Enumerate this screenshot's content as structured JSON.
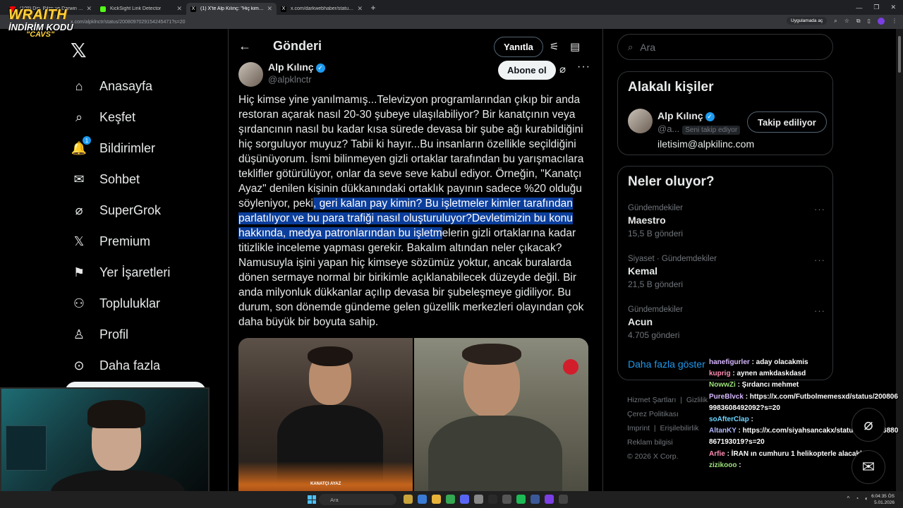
{
  "browser": {
    "tabs": [
      {
        "title": "(108) Din, Bilim ve Darwin - You",
        "color": "#ff0000"
      },
      {
        "title": "KickSight Link Detector",
        "color": "#53fc18"
      },
      {
        "title": "(1) X'te Alp Kılınç: \"Hiç kimse y",
        "color": "#ffffff"
      },
      {
        "title": "x.com/darkwebhaber/status/20",
        "color": "#ffffff"
      }
    ],
    "url": "x.com/alpklnctr/status/2008097029154245471?s=20",
    "open_in_app": "Uygulamada aç"
  },
  "nav": {
    "items": [
      {
        "label": "Anasayfa",
        "icon": "home-icon",
        "glyph": "⌂"
      },
      {
        "label": "Keşfet",
        "icon": "search-icon",
        "glyph": "⌕"
      },
      {
        "label": "Bildirimler",
        "icon": "bell-icon",
        "glyph": "🔔"
      },
      {
        "label": "Sohbet",
        "icon": "mail-icon",
        "glyph": "✉"
      },
      {
        "label": "SuperGrok",
        "icon": "grok-icon",
        "glyph": "⌀"
      },
      {
        "label": "Premium",
        "icon": "x-logo-icon",
        "glyph": "𝕏"
      },
      {
        "label": "Yer İşaretleri",
        "icon": "bookmark-icon",
        "glyph": "⚑"
      },
      {
        "label": "Topluluklar",
        "icon": "communities-icon",
        "glyph": "⚇"
      },
      {
        "label": "Profil",
        "icon": "person-icon",
        "glyph": "♙"
      },
      {
        "label": "Daha fazla",
        "icon": "more-circle-icon",
        "glyph": "⊙"
      }
    ],
    "notification_count": "1"
  },
  "header": {
    "title": "Gönderi",
    "reply_label": "Yanıtla"
  },
  "post": {
    "author_name": "Alp Kılınç",
    "handle": "@alpklnctr",
    "follow_label": "Abone ol",
    "text_before": "Hiç kimse yine yanılmamış...Televizyon programlarından çıkıp bir anda restoran açarak nasıl 20-30 şubeye ulaşılabiliyor? Bir kanatçının veya şırdancının nasıl bu kadar kısa sürede devasa bir şube ağı kurabildiğini hiç sorguluyor muyuz? Tabii ki hayır...Bu insanların özellikle seçildiğini düşünüyorum. İsmi bilinmeyen gizli ortaklar tarafından bu yarışmacılara teklifler götürülüyor, onlar da seve seve kabul ediyor. Örneğin, \"Kanatçı Ayaz\" denilen kişinin dükkanındaki ortaklık payının sadece %20 olduğu söyleniyor, peki",
    "text_highlight": ", geri kalan pay kimin? Bu işletmeler kimler tarafından parlatılıyor ve bu para trafiği nasıl oluşturuluyor?Devletimizin bu konu hakkında, medya patronlarından bu işletm",
    "text_after": "elerin gizli ortaklarına kadar titizlikle inceleme yapması gerekir. Bakalım altından neler çıkacak? Namusuyla işini yapan hiç kimseye sözümüz yoktur, ancak buralarda dönen sermaye normal bir birikimle açıklanabilecek düzeyde değil. Bir anda milyonluk dükkanlar açılıp devasa bir şubeleşmeye gidiliyor. Bu durum, son dönemde gündeme gelen güzellik merkezleri olayından çok daha büyük bir boyuta sahip.",
    "photo_brand": "KANATÇI AYAZ"
  },
  "search": {
    "placeholder": "Ara"
  },
  "related": {
    "title": "Alakalı kişiler",
    "name": "Alp Kılınç",
    "handle": "@a...",
    "follows_you": "Seni takip ediyor",
    "bio": "iletisim@alpkilinc.com",
    "following_label": "Takip ediliyor"
  },
  "trends": {
    "title": "Neler oluyor?",
    "items": [
      {
        "category": "Gündemdekiler",
        "name": "Maestro",
        "count": "15,5 B gönderi"
      },
      {
        "category": "Siyaset · Gündemdekiler",
        "name": "Kemal",
        "count": "21,5 B gönderi"
      },
      {
        "category": "Gündemdekiler",
        "name": "Acun",
        "count": "4.705 gönderi"
      }
    ],
    "show_more": "Daha fazla göster"
  },
  "footer": {
    "terms": "Hizmet Şartları",
    "privacy": "Gizlilik",
    "cookies": "Çerez Politikası",
    "imprint": "Imprint",
    "accessibility": "Erişilebilirlik",
    "ads": "Reklam bilgisi",
    "copyright": "© 2026 X Corp."
  },
  "overlay": {
    "brand": "WRAITH",
    "promo": "İNDİRİM KODU",
    "code": "\"CAVS\""
  },
  "chat": [
    {
      "user": "hanefigurler",
      "msg": ": aday olacakmis",
      "cls": "u1"
    },
    {
      "user": "kuprig",
      "msg": ": aynen amkdaskdasd",
      "cls": "u3"
    },
    {
      "user": "NowwZi",
      "msg": ": Şırdancı mehmet",
      "cls": "u4"
    },
    {
      "user": "PureBlvck",
      "msg": ": https://x.com/Futbolmemesxd/status/2008069983608492092?s=20",
      "cls": "u1"
    },
    {
      "user": "soAfterClap",
      "msg": ":",
      "cls": "u2"
    },
    {
      "user": "AltanKY",
      "msg": ": https://x.com/siyahsancakx/status/2008106880867193019?s=20",
      "cls": "u5"
    },
    {
      "user": "Arfie",
      "msg": ": İRAN ın cumhuru 1 helikopterle alacaklar",
      "cls": "u3"
    },
    {
      "user": "zizikooo",
      "msg": ":",
      "cls": "u4"
    }
  ],
  "taskbar": {
    "search": "Ara",
    "time": "6:04:35 ÖS",
    "date": "5.01.2026"
  }
}
